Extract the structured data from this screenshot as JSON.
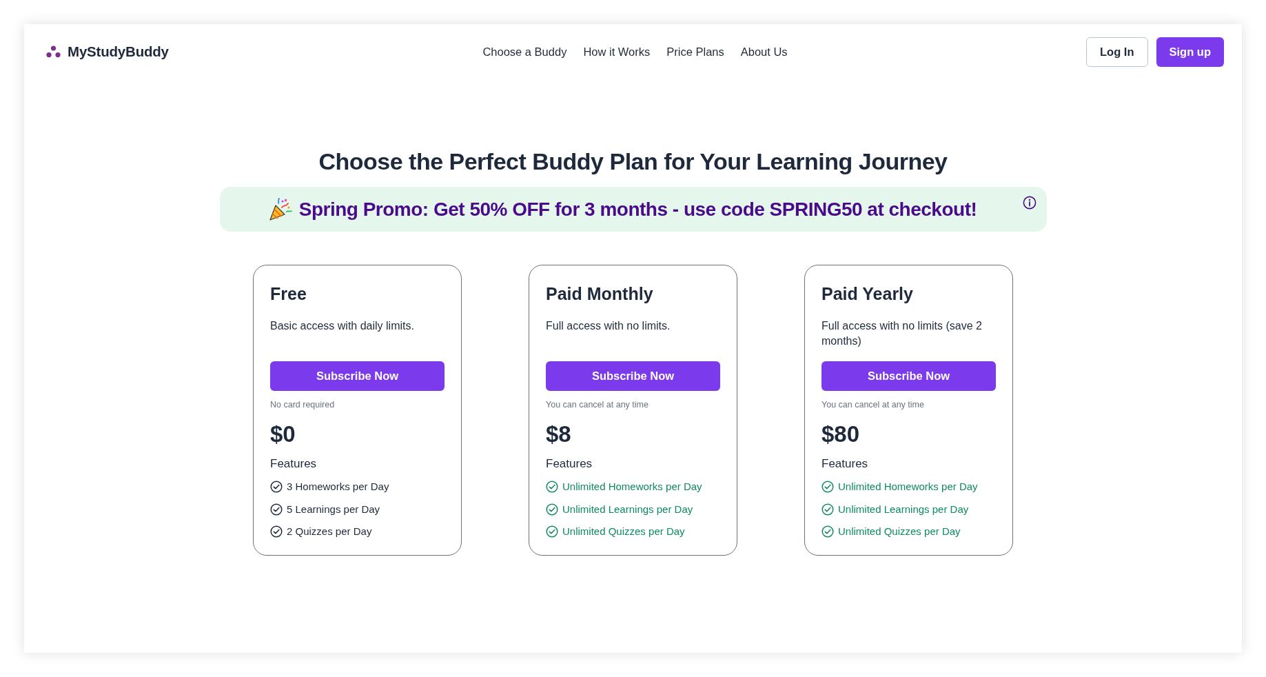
{
  "header": {
    "logo": "MyStudyBuddy",
    "nav": [
      "Choose a Buddy",
      "How it Works",
      "Price Plans",
      "About Us"
    ],
    "buttons": [
      {
        "label": "Log In",
        "kind": "outline"
      },
      {
        "label": "Sign up",
        "kind": "primary"
      }
    ]
  },
  "heading": "Choose the Perfect Buddy Plan for Your Learning Journey",
  "promo": {
    "text": "Spring Promo: Get 50% OFF for 3 months - use code SPRING50 at checkout!"
  },
  "plans": [
    {
      "name": "Free",
      "description": "Basic access with daily limits.",
      "button": "Subscribe Now",
      "note": "No card required",
      "price": "$0",
      "features_label": "Features",
      "features": [
        {
          "text": "3 Homeworks per Day",
          "highlighted": false
        },
        {
          "text": "5 Learnings per Day",
          "highlighted": false
        },
        {
          "text": "2 Quizzes per Day",
          "highlighted": false
        }
      ]
    },
    {
      "name": "Paid Monthly",
      "description": "Full access with no limits.",
      "button": "Subscribe Now",
      "note": "You can cancel at any time",
      "price": "$8",
      "features_label": "Features",
      "features": [
        {
          "text": "Unlimited Homeworks per Day",
          "highlighted": true
        },
        {
          "text": "Unlimited Learnings per Day",
          "highlighted": true
        },
        {
          "text": "Unlimited Quizzes per Day",
          "highlighted": true
        }
      ]
    },
    {
      "name": "Paid Yearly",
      "description": "Full access with no limits (save 2 months)",
      "button": "Subscribe Now",
      "note": "You can cancel at any time",
      "price": "$80",
      "features_label": "Features",
      "features": [
        {
          "text": "Unlimited Homeworks per Day",
          "highlighted": true
        },
        {
          "text": "Unlimited Learnings per Day",
          "highlighted": true
        },
        {
          "text": "Unlimited Quizzes per Day",
          "highlighted": true
        }
      ]
    }
  ]
}
